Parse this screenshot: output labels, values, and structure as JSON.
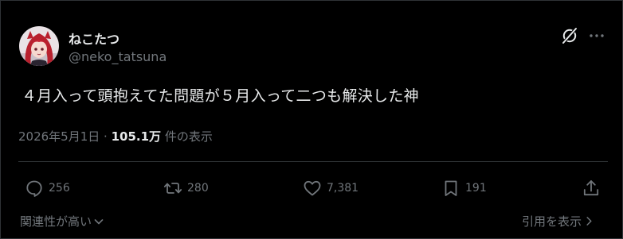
{
  "user": {
    "display_name": "ねこたつ",
    "handle": "@neko_tatsuna"
  },
  "post": {
    "text": "４月入って頭抱えてた問題が５月入って二つも解決した神"
  },
  "meta": {
    "date": "2026年5月1日",
    "separator": "·",
    "views_count": "105.1万",
    "views_label": "件の表示"
  },
  "actions": {
    "reply_count": "256",
    "repost_count": "280",
    "like_count": "7,381",
    "bookmark_count": "191"
  },
  "footer": {
    "relevance_label": "関連性が高い",
    "quotes_label": "引用を表示"
  },
  "icons": {
    "header": [
      "grok-icon",
      "more-icon"
    ],
    "actions": [
      "reply-icon",
      "repost-icon",
      "like-icon",
      "bookmark-icon",
      "share-icon"
    ],
    "footer": [
      "chevron-down-icon",
      "chevron-right-icon"
    ]
  },
  "colors": {
    "background": "#000000",
    "primary_text": "#e7e9ea",
    "secondary_text": "#71767b",
    "border": "#2f3336",
    "avatar_hair": "#b8202e"
  }
}
